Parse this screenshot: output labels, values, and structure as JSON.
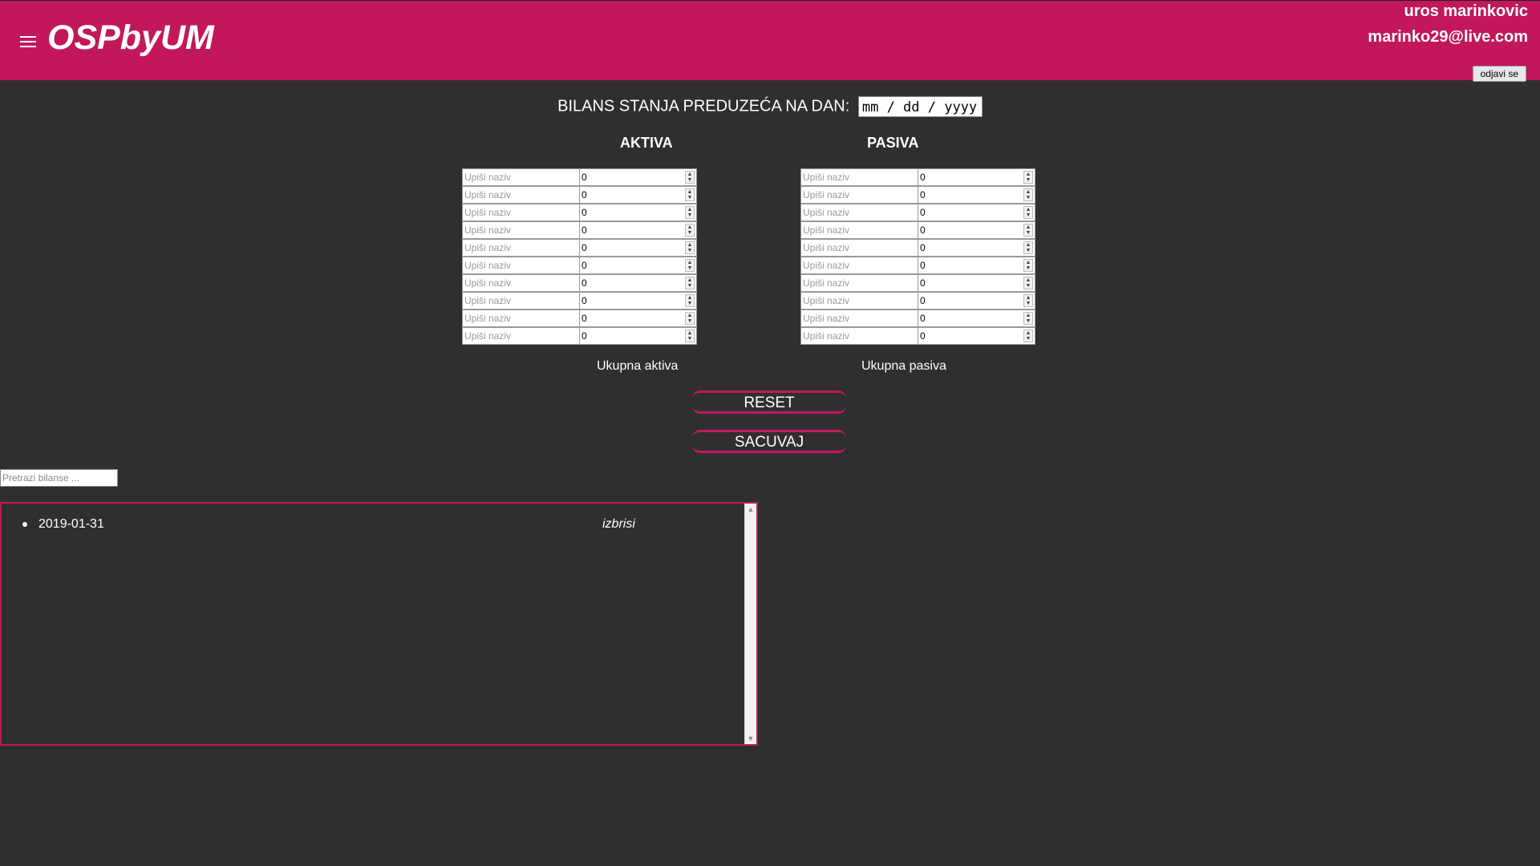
{
  "header": {
    "app_title": "OSPbyUM",
    "user_name": "uros marinkovic",
    "user_email": "marinko29@live.com",
    "logout_label": "odjavi se",
    "bg_color": "#c2185b"
  },
  "form": {
    "date_label": "BILANS STANJA PREDUZEĆA NA DAN:",
    "date_placeholder": "mm / dd / yyyy",
    "aktiva": {
      "title": "AKTIVA",
      "rows": [
        {
          "name_placeholder": "Upiši naziv",
          "value": "0"
        },
        {
          "name_placeholder": "Upiši naziv",
          "value": "0"
        },
        {
          "name_placeholder": "Upiši naziv",
          "value": "0"
        },
        {
          "name_placeholder": "Upiši naziv",
          "value": "0"
        },
        {
          "name_placeholder": "Upiši naziv",
          "value": "0"
        },
        {
          "name_placeholder": "Upiši naziv",
          "value": "0"
        },
        {
          "name_placeholder": "Upiši naziv",
          "value": "0"
        },
        {
          "name_placeholder": "Upiši naziv",
          "value": "0"
        },
        {
          "name_placeholder": "Upiši naziv",
          "value": "0"
        },
        {
          "name_placeholder": "Upiši naziv",
          "value": "0"
        }
      ],
      "total_label": "Ukupna aktiva"
    },
    "pasiva": {
      "title": "PASIVA",
      "rows": [
        {
          "name_placeholder": "Upiši naziv",
          "value": "0"
        },
        {
          "name_placeholder": "Upiši naziv",
          "value": "0"
        },
        {
          "name_placeholder": "Upiši naziv",
          "value": "0"
        },
        {
          "name_placeholder": "Upiši naziv",
          "value": "0"
        },
        {
          "name_placeholder": "Upiši naziv",
          "value": "0"
        },
        {
          "name_placeholder": "Upiši naziv",
          "value": "0"
        },
        {
          "name_placeholder": "Upiši naziv",
          "value": "0"
        },
        {
          "name_placeholder": "Upiši naziv",
          "value": "0"
        },
        {
          "name_placeholder": "Upiši naziv",
          "value": "0"
        },
        {
          "name_placeholder": "Upiši naziv",
          "value": "0"
        }
      ],
      "total_label": "Ukupna pasiva"
    },
    "reset_label": "RESET",
    "save_label": "SACUVAJ"
  },
  "search": {
    "placeholder": "Pretrazi bilanse ..."
  },
  "list": {
    "items": [
      {
        "date": "2019-01-31",
        "delete_label": "izbrisi"
      }
    ]
  }
}
